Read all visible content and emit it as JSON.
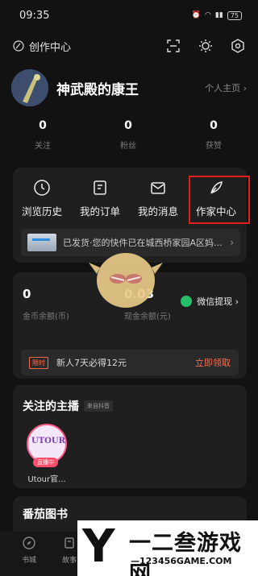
{
  "status": {
    "time": "09:35",
    "battery": "75"
  },
  "header": {
    "creator_center": "创作中心"
  },
  "profile": {
    "username": "神武殿的康王",
    "homepage": "个人主页 ›"
  },
  "stats": [
    {
      "value": "0",
      "label": "关注"
    },
    {
      "value": "0",
      "label": "粉丝"
    },
    {
      "value": "0",
      "label": "获赞"
    }
  ],
  "menu": [
    {
      "label": "浏览历史"
    },
    {
      "label": "我的订单"
    },
    {
      "label": "我的消息"
    },
    {
      "label": "作家中心"
    }
  ],
  "notice": {
    "text": "已发货·您的快件已在城西桥家园A区妈..."
  },
  "wallet": {
    "coins_value": "0",
    "coins_label": "金币余额(币)",
    "cash_value": "0.03",
    "cash_label": "现金余额(元)",
    "withdraw": "微信提现 ›"
  },
  "promo": {
    "tag": "限时",
    "text": "新人7天必得12元",
    "action": "立即领取"
  },
  "streamers": {
    "title": "关注的主播",
    "source": "来自抖音",
    "items": [
      {
        "name": "Utour官...",
        "logo": "UTOUR",
        "live": "直播中"
      }
    ]
  },
  "books": {
    "title": "番茄图书"
  },
  "tabbar": [
    {
      "label": "书城"
    },
    {
      "label": "故事"
    }
  ],
  "watermark": {
    "letter": "Y",
    "name": "一二叁游戏网",
    "url": "—123456GAME.COM"
  },
  "colors": {
    "highlight": "#e31e1e",
    "wechat": "#27c06a",
    "accent": "#ff6b4a"
  }
}
